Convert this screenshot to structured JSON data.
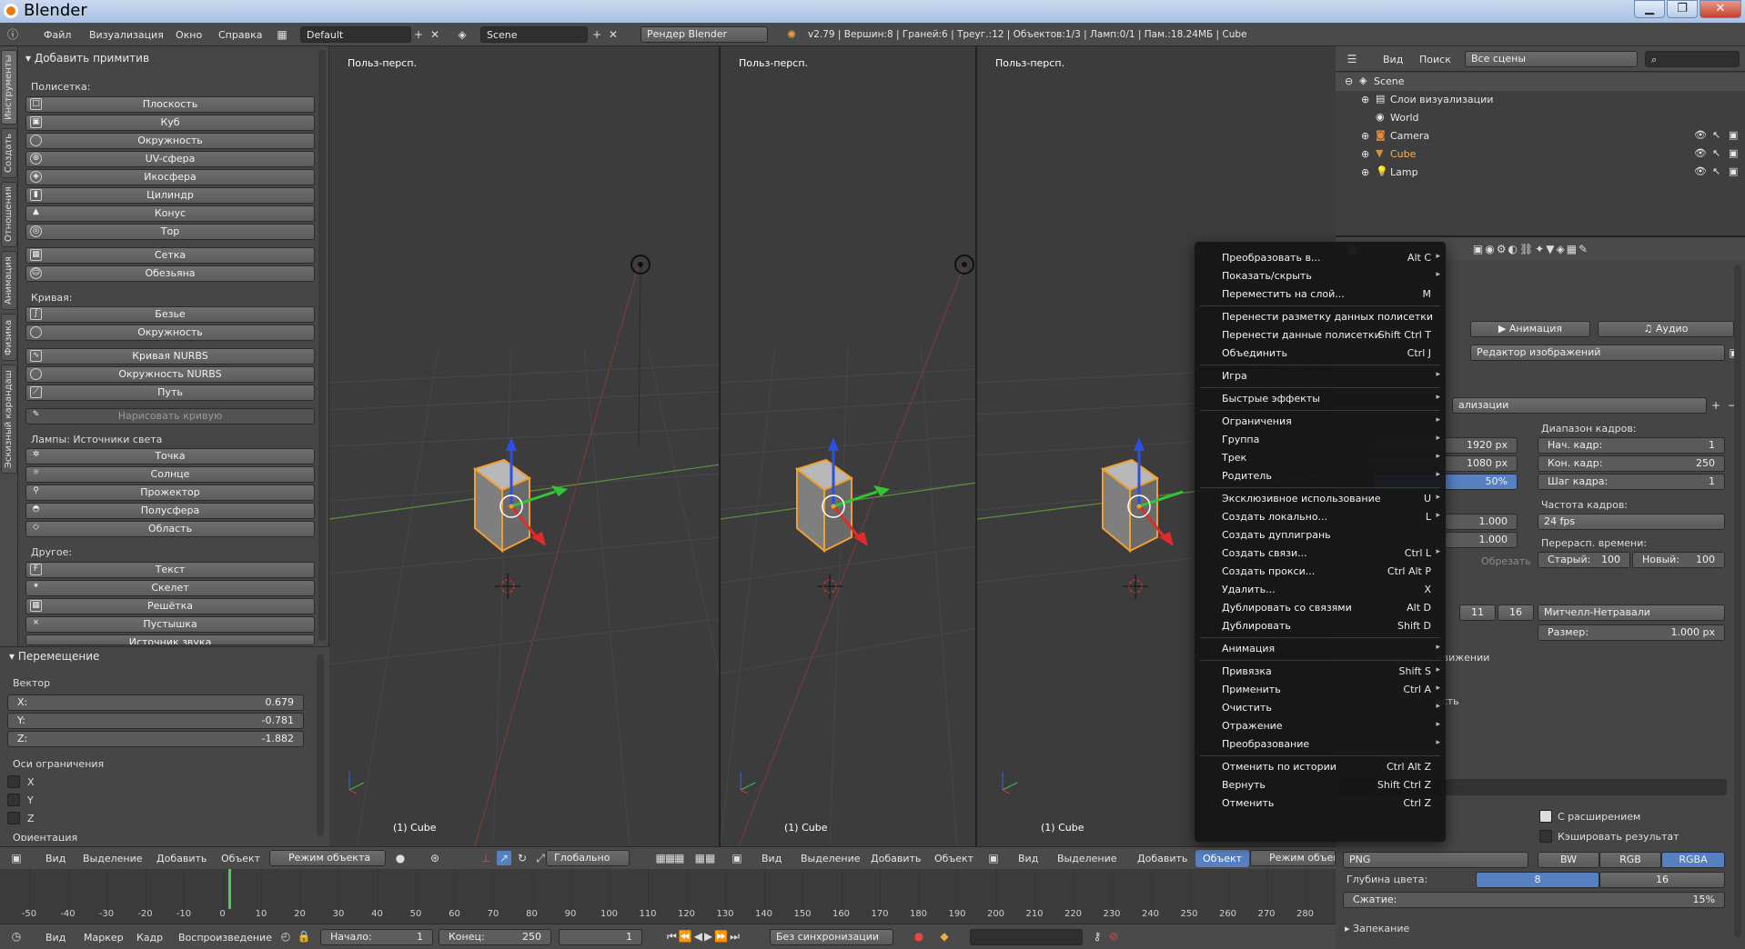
{
  "window": {
    "title": "Blender"
  },
  "info_header": {
    "menus": [
      "Файл",
      "Визуализация",
      "Окно",
      "Справка"
    ],
    "layout": "Default",
    "scene": "Scene",
    "engine": "Рендер Blender",
    "stats": "v2.79 | Вершин:8 | Граней:6 | Треуг.:12 | Объектов:1/3 | Ламп:0/1 | Пам.:18.24МБ | Cube"
  },
  "toolshelf": {
    "tabs": [
      "Инструменты",
      "Создать",
      "Отношения",
      "Анимация",
      "Физика",
      "Эскизный карандаш"
    ],
    "panel_title": "Добавить примитив",
    "sections": [
      {
        "title": "Полисетка:",
        "items": [
          "Плоскость",
          "Куб",
          "Окружность",
          "UV-сфера",
          "Икосфера",
          "Цилиндр",
          "Конус",
          "Тор",
          "Сетка",
          "Обезьяна"
        ]
      },
      {
        "title": "Кривая:",
        "items": [
          "Безье",
          "Окружность",
          "Кривая NURBS",
          "Окружность NURBS",
          "Путь",
          "Нарисовать кривую"
        ]
      },
      {
        "title": "Лампы: Источники света",
        "items": [
          "Точка",
          "Солнце",
          "Прожектор",
          "Полусфера",
          "Область"
        ]
      },
      {
        "title": "Другое:",
        "items": [
          "Текст",
          "Скелет",
          "Решётка",
          "Пустышка",
          "Источник звука"
        ]
      }
    ]
  },
  "redo_panel": {
    "title": "Перемещение",
    "vector_label": "Вектор",
    "x_label": "X:",
    "x": "0.679",
    "y_label": "Y:",
    "y": "-0.781",
    "z_label": "Z:",
    "z": "-1.882",
    "constraint_label": "Оси ограничения",
    "axes": [
      "X",
      "Y",
      "Z"
    ],
    "orientation_label": "Ориентация"
  },
  "viewports": [
    {
      "label": "Польз-персп.",
      "object": "(1) Cube"
    },
    {
      "label": "Польз-персп.",
      "object": "(1) Cube"
    },
    {
      "label": "Польз-персп.",
      "object": "(1) Cube"
    }
  ],
  "view_header": {
    "view": "Вид",
    "select": "Выделение",
    "add": "Добавить",
    "object": "Объект",
    "mode": "Режим объекта",
    "transform": "Глобально",
    "mode_short": "Режим объек"
  },
  "timeline": {
    "ticks": [
      "-50",
      "-40",
      "-30",
      "-20",
      "-10",
      "0",
      "10",
      "20",
      "30",
      "40",
      "50",
      "60",
      "70",
      "80",
      "90",
      "100",
      "110",
      "120",
      "130",
      "140",
      "150",
      "160",
      "170",
      "180",
      "190",
      "200",
      "210",
      "220",
      "230",
      "240",
      "250",
      "260",
      "270",
      "280"
    ],
    "menus": [
      "Вид",
      "Маркер",
      "Кадр",
      "Воспроизведение"
    ],
    "start_label": "Начало:",
    "start": "1",
    "end_label": "Конец:",
    "end": "250",
    "current": "1",
    "sync": "Без синхронизации"
  },
  "outliner": {
    "view": "Вид",
    "search": "Поиск",
    "filter": "Все сцены",
    "rows": [
      "Scene",
      "Слои визуализации",
      "World",
      "Camera",
      "Cube",
      "Lamp"
    ]
  },
  "properties": {
    "tab_animation": "Анимация",
    "tab_audio": "Аудио",
    "display": "Редактор изображений",
    "presets": "ализации",
    "res_x": "1920 px",
    "res_y": "1080 px",
    "res_pct": "50%",
    "frame_range_label": "Диапазон кадров:",
    "start_frame": "Нач. кадр:",
    "start_frame_v": "1",
    "end_frame": "Кон. кадр:",
    "end_frame_v": "250",
    "frame_step": "Шаг кадра:",
    "frame_step_v": "1",
    "aspect_x": "1.000",
    "aspect_y": "1.000",
    "fps_label": "Частота кадров:",
    "fps": "24 fps",
    "time_remap_label": "Перерасп. времени:",
    "old": "Старый:",
    "old_v": "100",
    "new": "Новый:",
    "new_v": "100",
    "crop": "Обрезать",
    "aa_11": "11",
    "aa_16": "16",
    "filter": "Митчелл-Нетравали",
    "size_label": "Размер:",
    "size": "1.000 px",
    "motion_blur": "движении",
    "perf": "ость",
    "ext": "С расширением",
    "cache": "Кэшировать результат",
    "format": "PNG",
    "bw": "BW",
    "rgb": "RGB",
    "rgba": "RGBA",
    "depth_label": "Глубина цвета:",
    "depth_8": "8",
    "depth_16": "16",
    "compress_label": "Сжатие:",
    "compress": "15%",
    "bake": "Запекание"
  },
  "context_menu": [
    {
      "label": "Преобразовать в...",
      "key": "Alt C",
      "sub": true
    },
    {
      "label": "Показать/скрыть",
      "key": "",
      "sub": true
    },
    {
      "label": "Переместить на слой...",
      "key": "M",
      "sub": false
    },
    {
      "sep": true
    },
    {
      "label": "Перенести разметку данных полисетки",
      "key": "",
      "sub": false
    },
    {
      "label": "Перенести данные полисетки",
      "key": "Shift Ctrl T",
      "sub": false
    },
    {
      "label": "Объединить",
      "key": "Ctrl J",
      "sub": false
    },
    {
      "sep": true
    },
    {
      "label": "Игра",
      "key": "",
      "sub": true
    },
    {
      "sep": true
    },
    {
      "label": "Быстрые эффекты",
      "key": "",
      "sub": true
    },
    {
      "sep": true
    },
    {
      "label": "Ограничения",
      "key": "",
      "sub": true
    },
    {
      "label": "Группа",
      "key": "",
      "sub": true
    },
    {
      "label": "Трек",
      "key": "",
      "sub": true
    },
    {
      "label": "Родитель",
      "key": "",
      "sub": true
    },
    {
      "sep": true
    },
    {
      "label": "Эксклюзивное использование",
      "key": "U",
      "sub": true
    },
    {
      "label": "Создать локально...",
      "key": "L",
      "sub": true
    },
    {
      "label": "Создать дуплигрань",
      "key": "",
      "sub": false
    },
    {
      "label": "Создать связи...",
      "key": "Ctrl L",
      "sub": true
    },
    {
      "label": "Создать прокси...",
      "key": "Ctrl Alt P",
      "sub": false
    },
    {
      "label": "Удалить...",
      "key": "X",
      "sub": false
    },
    {
      "label": "Дублировать со связями",
      "key": "Alt D",
      "sub": false
    },
    {
      "label": "Дублировать",
      "key": "Shift D",
      "sub": false
    },
    {
      "sep": true
    },
    {
      "label": "Анимация",
      "key": "",
      "sub": true
    },
    {
      "sep": true
    },
    {
      "label": "Привязка",
      "key": "Shift S",
      "sub": true
    },
    {
      "label": "Применить",
      "key": "Ctrl A",
      "sub": true
    },
    {
      "label": "Очистить",
      "key": "",
      "sub": true
    },
    {
      "label": "Отражение",
      "key": "",
      "sub": true
    },
    {
      "label": "Преобразование",
      "key": "",
      "sub": true
    },
    {
      "sep": true
    },
    {
      "label": "Отменить по истории",
      "key": "Ctrl Alt Z",
      "sub": false
    },
    {
      "label": "Вернуть",
      "key": "Shift Ctrl Z",
      "sub": false
    },
    {
      "label": "Отменить",
      "key": "Ctrl Z",
      "sub": false
    }
  ],
  "colors": {
    "accent": "#5680c2",
    "selection": "#f0a030",
    "bg": "#393939"
  }
}
